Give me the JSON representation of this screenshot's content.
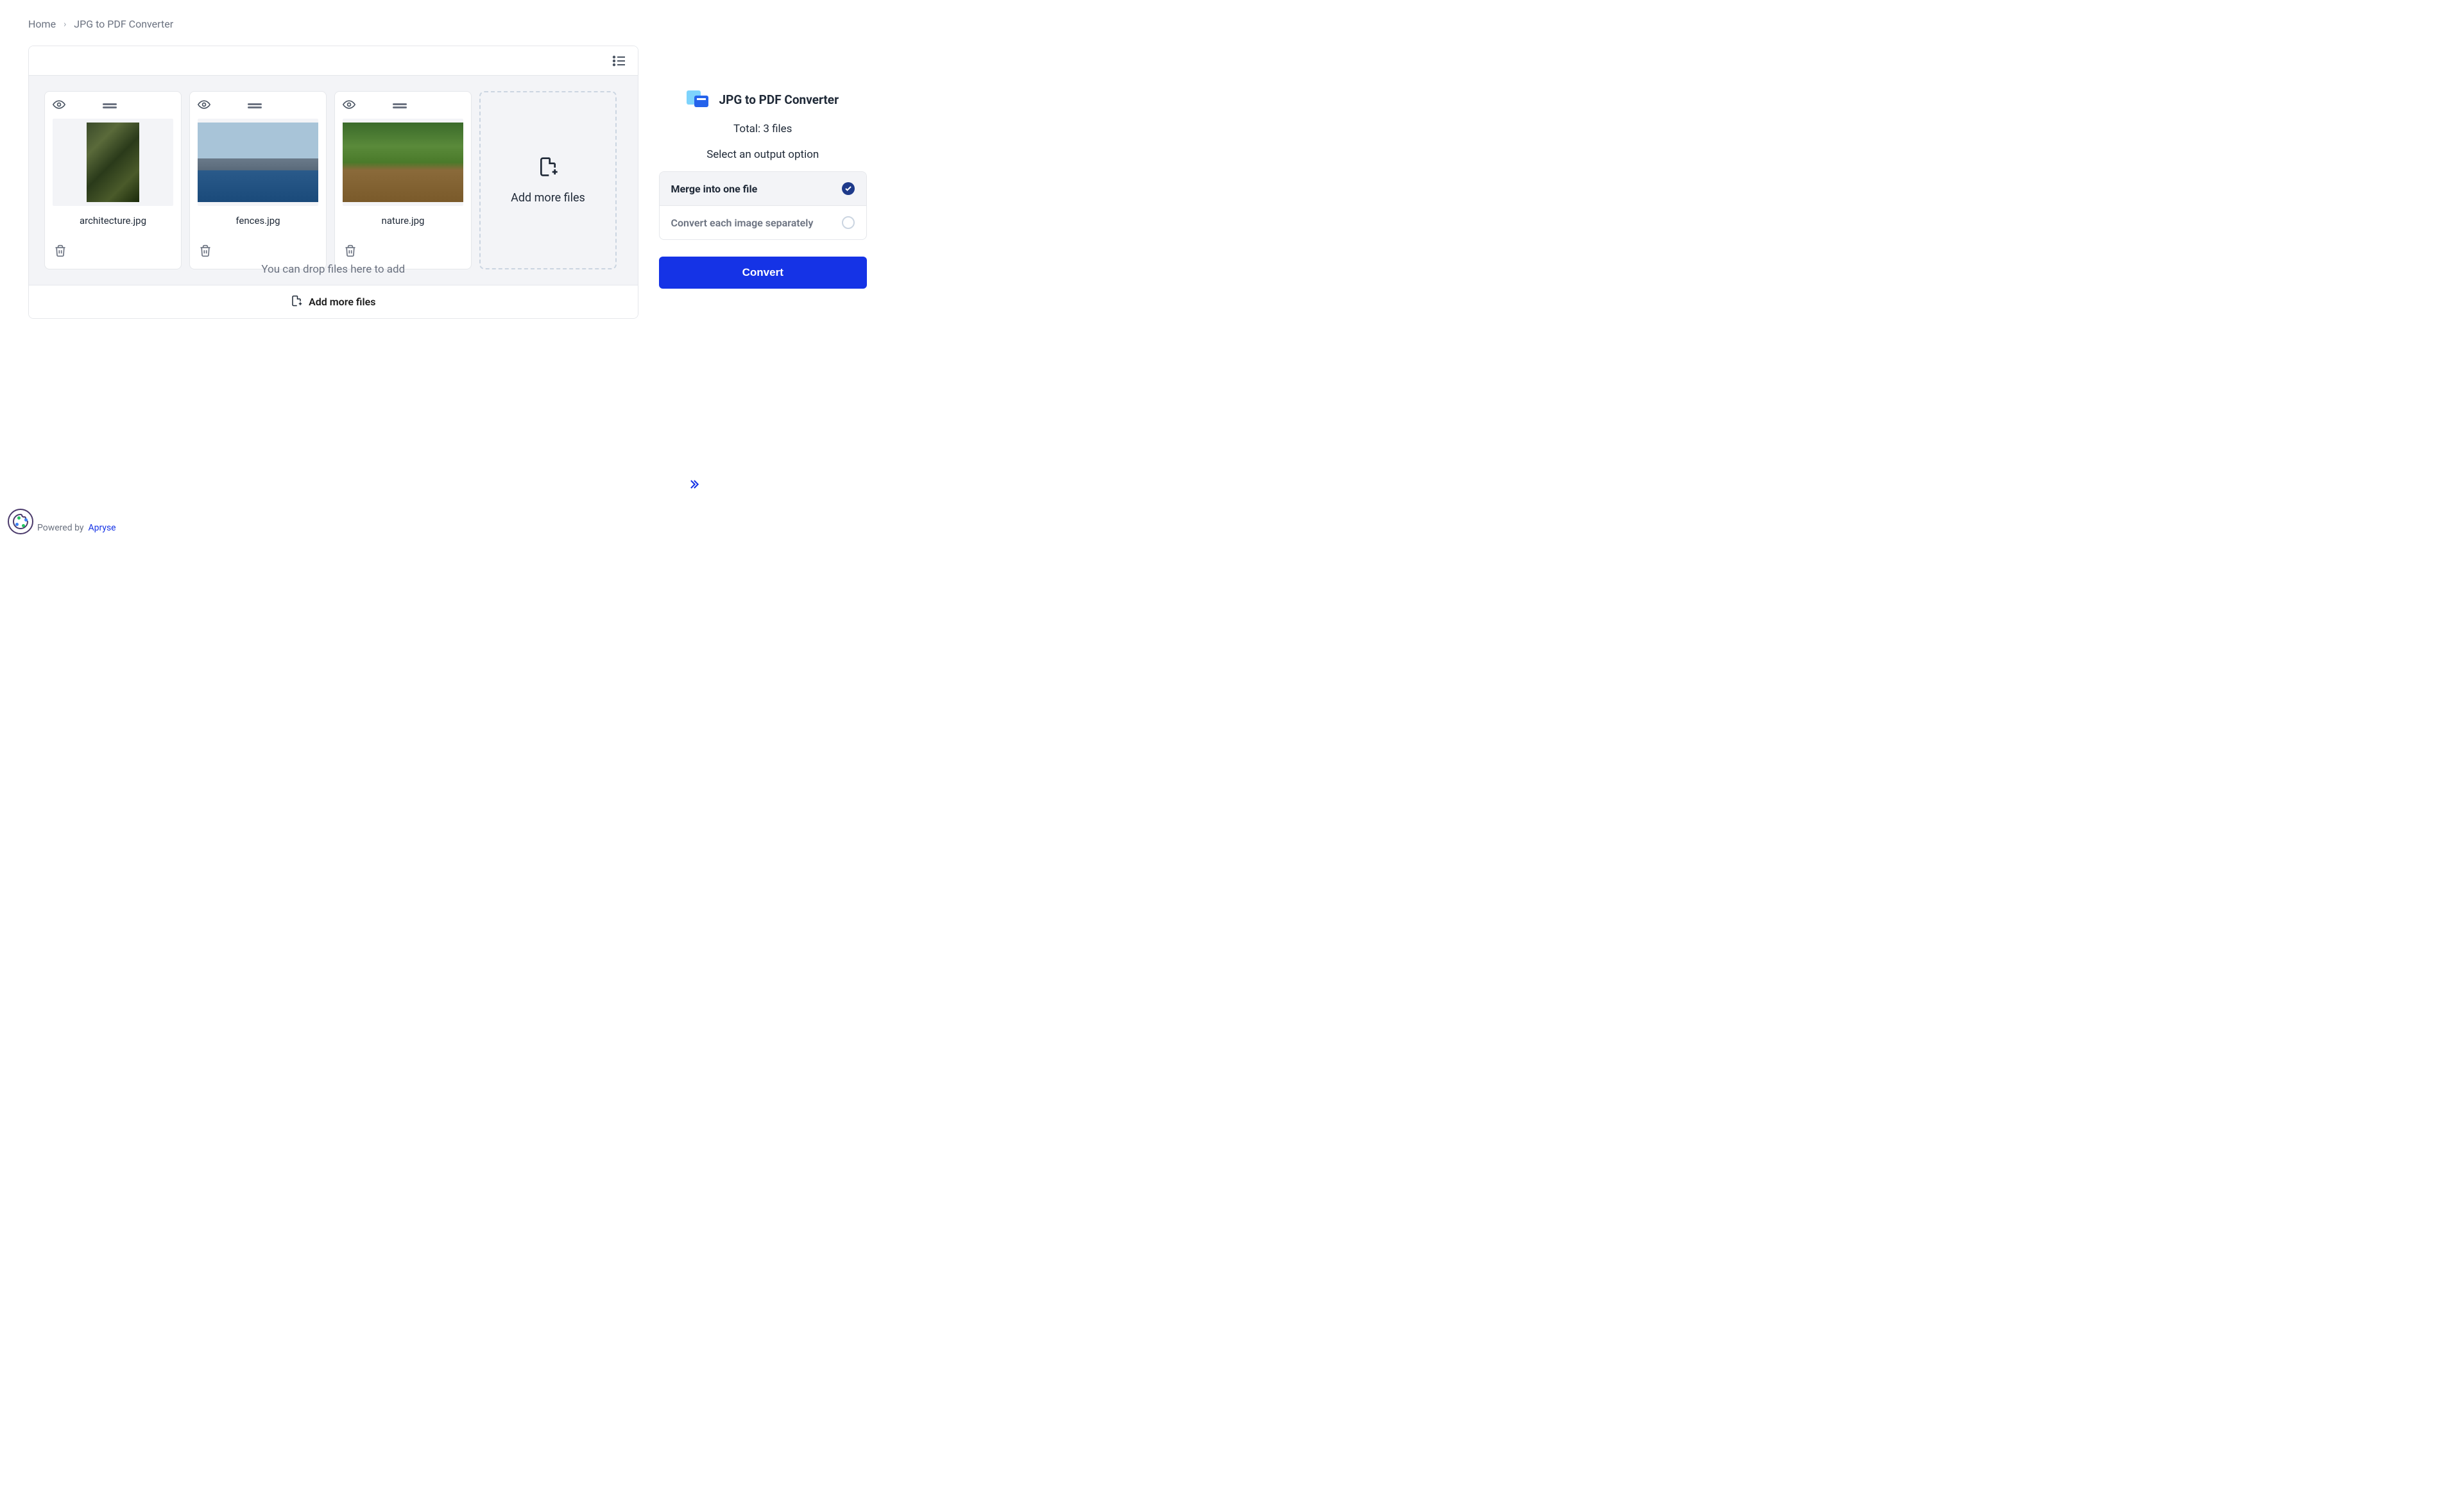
{
  "breadcrumb": {
    "home": "Home",
    "current": "JPG to PDF Converter"
  },
  "files": [
    {
      "name": "architecture.jpg"
    },
    {
      "name": "fences.jpg"
    },
    {
      "name": "nature.jpg"
    }
  ],
  "add_tile": "Add more files",
  "drop_hint": "You can drop files here to add",
  "add_bar": "Add more files",
  "panel": {
    "title": "JPG to PDF Converter",
    "total": "Total: 3 files",
    "select_label": "Select an output option",
    "options": {
      "merge": "Merge into one file",
      "separate": "Convert each image separately"
    },
    "convert": "Convert"
  },
  "footer": {
    "powered": "Powered by",
    "brand": "Apryse"
  }
}
